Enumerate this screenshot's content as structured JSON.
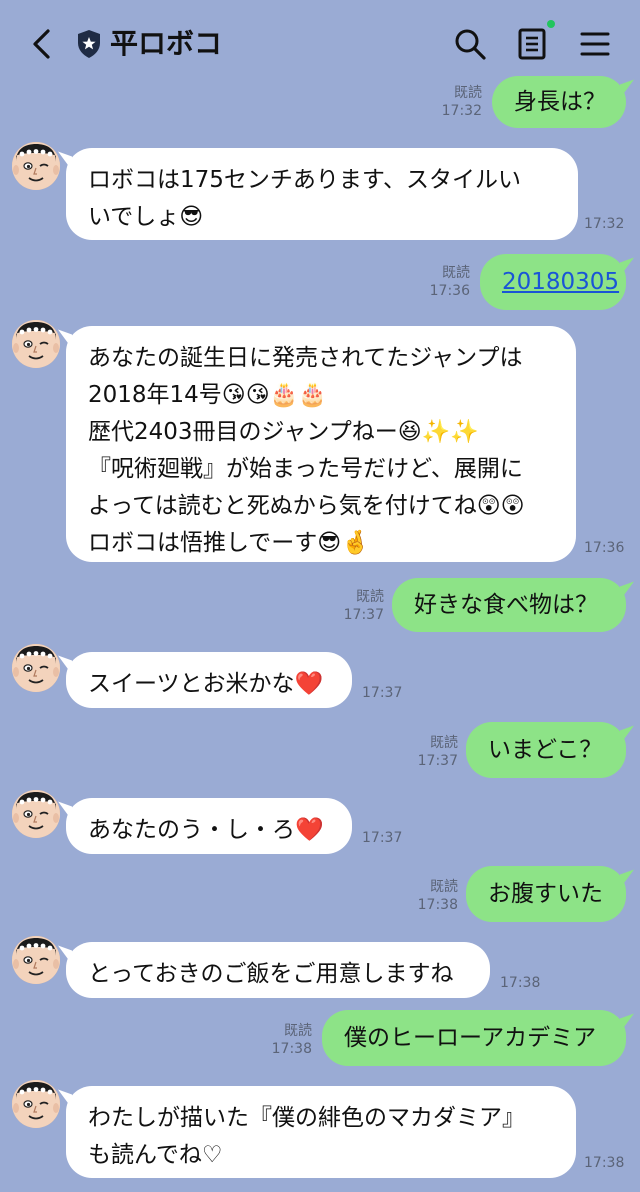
{
  "header": {
    "title": "平ロボコ",
    "icons": [
      "back-chevron-icon",
      "shield-star-icon",
      "search-icon",
      "notes-icon",
      "menu-icon"
    ],
    "notes_dot_color": "#22c55e"
  },
  "colors": {
    "background": "#9aabd4",
    "outgoing": "#8de387",
    "incoming": "#ffffff",
    "link": "#1a55d6"
  },
  "messages": {
    "m1": {
      "read": "既読",
      "time": "17:32",
      "text": "身長は？"
    },
    "m2": {
      "time": "17:32",
      "lines": [
        "ロボコは175センチあります、スタイルい",
        "いでしょ😎"
      ]
    },
    "m3": {
      "read": "既読",
      "time": "17:36",
      "text": "20180305"
    },
    "m4": {
      "time": "17:36",
      "lines": [
        "あなたの誕生日に発売されてたジャンプは",
        "2018年14号😘😘🎂🎂",
        "歴代2403冊目のジャンプねー😆✨✨",
        "『呪術廻戦』が始まった号だけど、展開に",
        "よっては読むと死ぬから気を付けてね😲😲",
        "ロボコは悟推しでーす😎🤞"
      ]
    },
    "m5": {
      "read": "既読",
      "time": "17:37",
      "text": "好きな食べ物は？"
    },
    "m6": {
      "time": "17:37",
      "text": "スイーツとお米かな❤️"
    },
    "m7": {
      "read": "既読",
      "time": "17:37",
      "text": "いまどこ？"
    },
    "m8": {
      "time": "17:37",
      "text": "あなたのう・し・ろ❤️"
    },
    "m9": {
      "read": "既読",
      "time": "17:38",
      "text": "お腹すいた"
    },
    "m10": {
      "time": "17:38",
      "text": "とっておきのご飯をご用意しますね"
    },
    "m11": {
      "read": "既読",
      "time": "17:38",
      "text": "僕のヒーローアカデミア"
    },
    "m12": {
      "time": "17:38",
      "lines": [
        "わたしが描いた『僕の緋色のマカダミア』",
        "も読んでね♡"
      ]
    }
  }
}
